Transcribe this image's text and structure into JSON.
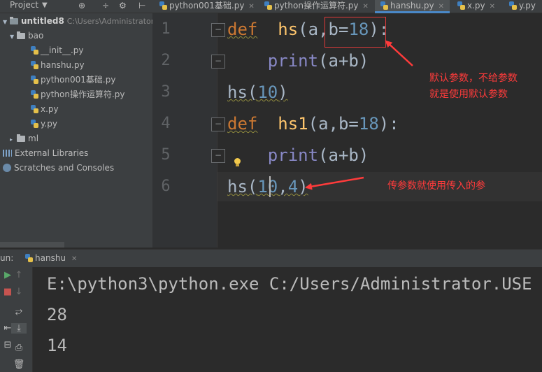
{
  "project_panel": {
    "title": "Project",
    "header_icons": [
      "⊕",
      "÷",
      "⚙",
      "⊢"
    ],
    "root_name": "untitled8",
    "root_path": "C:\\Users\\Administrator",
    "folder_bao": "bao",
    "files": [
      "__init__.py",
      "hanshu.py",
      "python001基础.py",
      "python操作运算符.py",
      "x.py",
      "y.py"
    ],
    "folder_ml": "ml",
    "external_libraries": "External Libraries",
    "scratches": "Scratches and Consoles"
  },
  "tabs": [
    {
      "label": "python001基础.py",
      "active": false
    },
    {
      "label": "python操作运算符.py",
      "active": false
    },
    {
      "label": "hanshu.py",
      "active": true
    },
    {
      "label": "x.py",
      "active": false
    },
    {
      "label": "y.py",
      "active": false
    }
  ],
  "editor": {
    "line_numbers": [
      "1",
      "2",
      "3",
      "4",
      "5",
      "6"
    ],
    "lines": {
      "l1": {
        "kw": "def",
        "fn": "hs",
        "open": "(a,",
        "param": "b=",
        "num": "18",
        "close": "):"
      },
      "l2": {
        "builtin": "print",
        "rest": "(a+b)"
      },
      "l3": {
        "call": "hs(",
        "num": "10",
        "close": ")"
      },
      "l4": {
        "kw": "def",
        "fn": "hs1",
        "open": "(a,b=",
        "num": "18",
        "close": "):"
      },
      "l5": {
        "builtin": "print",
        "rest": "(a+b)"
      },
      "l6": {
        "call": "hs(",
        "num1": "10",
        "comma": ",",
        "num2": "4",
        "close": ")"
      }
    },
    "annotation_1_line1": "默认参数，不给参数",
    "annotation_1_line2": "就是使用默认参数",
    "annotation_2": "传参数就使用传入的参",
    "annotation_color": "#ff3b3b"
  },
  "run_panel": {
    "label": "un:",
    "tab": "hanshu",
    "output": [
      "E:\\python3\\python.exe C:/Users/Administrator.USE",
      "28",
      "14"
    ]
  },
  "colors": {
    "keyword": "#cc7832",
    "function": "#ffc66d",
    "number": "#6897bb",
    "builtin": "#8888c6",
    "text": "#a9b7c6",
    "background": "#2b2b2b"
  }
}
